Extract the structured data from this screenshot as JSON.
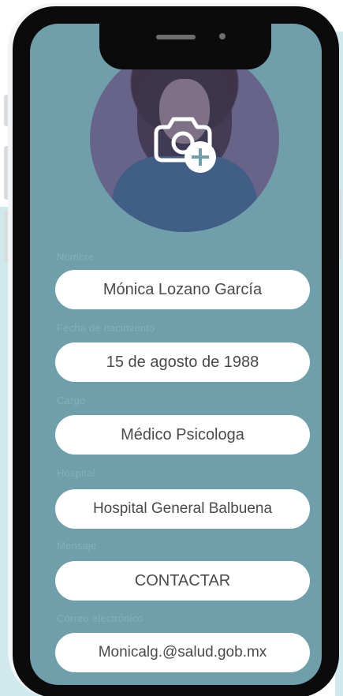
{
  "profile": {
    "photo_action_icon": "camera-plus-icon",
    "fields": [
      {
        "label": "Nombre",
        "value": "Mónica Lozano García"
      },
      {
        "label": "Fecha de nacimiento",
        "value": "15 de agosto de 1988"
      },
      {
        "label": "Cargo",
        "value": "Médico Psicologa"
      },
      {
        "label": "Hospital",
        "value": "Hospital General Balbuena"
      },
      {
        "label": "Mensaje",
        "value": "CONTACTAR"
      },
      {
        "label": "Correo electrónico",
        "value": "Monicalg.@salud.gob.mx"
      }
    ]
  },
  "colors": {
    "screen_background": "#6f9faa",
    "pill_background": "#ffffff",
    "label_text": "#86aeb8",
    "pill_text": "#4a4a4a",
    "page_tint": "#cfe9ec"
  }
}
